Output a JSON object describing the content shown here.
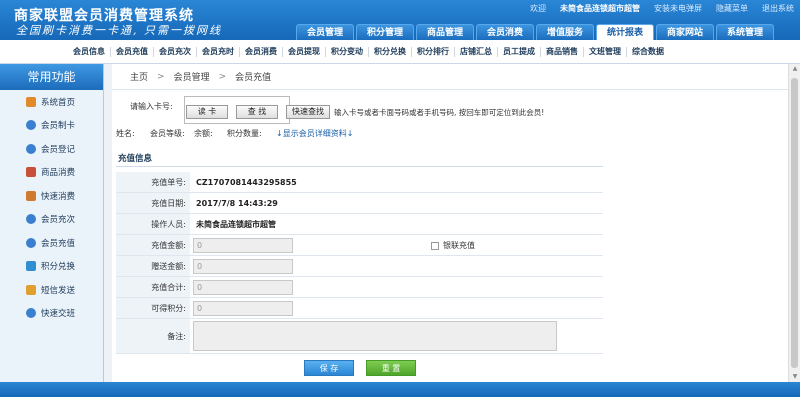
{
  "header": {
    "title": "商家联盟会员消费管理系统",
    "slogan": "全国刷卡消费一卡通, 只需一拨网线",
    "top_links": {
      "welcome": "欢迎",
      "store": "未简食品连锁超市超管",
      "assistant": "安装未电弹屏",
      "hide_menu": "隐藏菜单",
      "logout": "退出系统"
    },
    "main_nav": [
      "会员管理",
      "积分管理",
      "商品管理",
      "会员消费",
      "增值服务",
      "统计报表",
      "商家网站",
      "系统管理"
    ],
    "active_nav": "统计报表"
  },
  "subnav": [
    "会员信息",
    "会员充值",
    "会员充次",
    "会员充时",
    "会员消费",
    "会员提现",
    "积分变动",
    "积分兑换",
    "积分排行",
    "店铺汇总",
    "员工提成",
    "商品销售",
    "文班管理",
    "综合数据"
  ],
  "sidebar": {
    "heading": "常用功能",
    "items": [
      {
        "label": "系统首页",
        "icon": "home-icon",
        "color": "#e08a2a"
      },
      {
        "label": "会员制卡",
        "icon": "user-card-icon",
        "color": "#3b7fd0"
      },
      {
        "label": "会员登记",
        "icon": "user-add-icon",
        "color": "#3b7fd0"
      },
      {
        "label": "商品消费",
        "icon": "goods-icon",
        "color": "#c8503a"
      },
      {
        "label": "快速消费",
        "icon": "fast-consume-icon",
        "color": "#d07a30"
      },
      {
        "label": "会员充次",
        "icon": "user-count-icon",
        "color": "#3b7fd0"
      },
      {
        "label": "会员充值",
        "icon": "user-recharge-icon",
        "color": "#3b7fd0"
      },
      {
        "label": "积分兑换",
        "icon": "points-exchange-icon",
        "color": "#2f8fd0"
      },
      {
        "label": "短信发送",
        "icon": "sms-icon",
        "color": "#e0a030"
      },
      {
        "label": "快速交班",
        "icon": "shift-icon",
        "color": "#3b7fd0"
      }
    ]
  },
  "breadcrumb": [
    "主页",
    "会员管理",
    "会员充值"
  ],
  "search": {
    "label": "请输入卡号:",
    "card_value": "",
    "read_card": "读  卡",
    "find": "查  找",
    "quick_find": "快速查找",
    "hint": "输入卡号或者卡面号码或者手机号码, 按回车即可定位到此会员!"
  },
  "member_info": {
    "name": "姓名:",
    "level": "会员等级:",
    "balance": "余额:",
    "points": "积分数量:",
    "details_link": "↓显示会员详细资料↓"
  },
  "section_title": "充值信息",
  "form": {
    "order_no_label": "充值单号:",
    "order_no": "CZ1707081443295855",
    "date_label": "充值日期:",
    "date": "2017/7/8 14:43:29",
    "operator_label": "操作人员:",
    "operator": "未简食品连锁超市超管",
    "amount_label": "充值金额:",
    "amount": "0",
    "bank_label": "银联充值",
    "gift_label": "赠送金额:",
    "gift": "0",
    "total_label": "充值合计:",
    "total": "0",
    "points_label": "可得积分:",
    "points": "0",
    "remark_label": "备注:"
  },
  "buttons": {
    "save": "保  存",
    "reset": "重  置"
  },
  "colors": {
    "primary": "#1668b8",
    "save": "#2b86d4",
    "reset": "#4ea52a"
  }
}
